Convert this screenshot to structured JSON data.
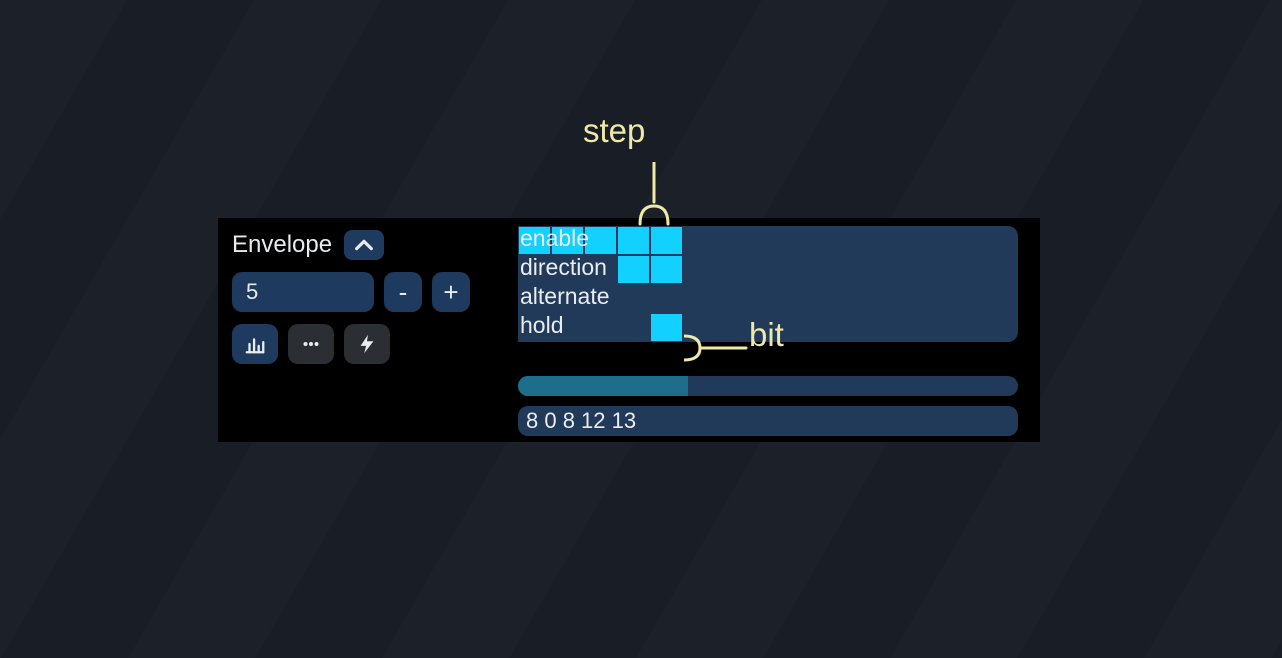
{
  "panel": {
    "title": "Envelope"
  },
  "controls": {
    "value": "5",
    "minus": "-",
    "plus": "+"
  },
  "grid": {
    "rows": [
      {
        "label": "enable",
        "bits": [
          true,
          true,
          true,
          true,
          true,
          false,
          false,
          false,
          false,
          false,
          false,
          false,
          false,
          false,
          false
        ]
      },
      {
        "label": "direction",
        "bits": [
          false,
          false,
          false,
          true,
          true,
          false,
          false,
          false,
          false,
          false,
          false,
          false,
          false,
          false,
          false
        ]
      },
      {
        "label": "alternate",
        "bits": [
          false,
          false,
          false,
          false,
          false,
          false,
          false,
          false,
          false,
          false,
          false,
          false,
          false,
          false,
          false
        ]
      },
      {
        "label": "hold",
        "bits": [
          false,
          false,
          false,
          false,
          true,
          false,
          false,
          false,
          false,
          false,
          false,
          false,
          false,
          false,
          false
        ]
      }
    ]
  },
  "progress": {
    "percent": 34
  },
  "values": "8 0 8 12 13",
  "annotations": {
    "step": "step",
    "bit": "bit"
  }
}
